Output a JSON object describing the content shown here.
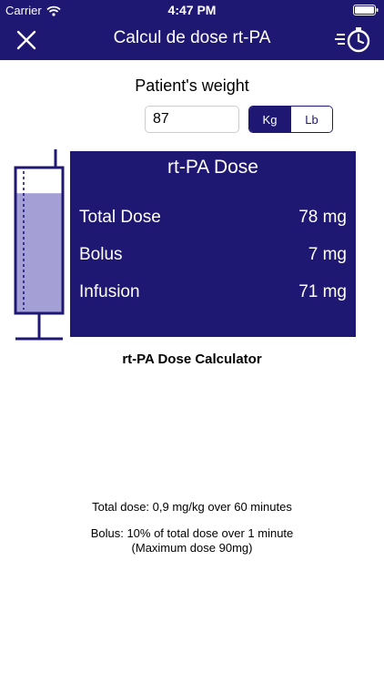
{
  "status_bar": {
    "carrier": "Carrier",
    "time": "4:47 PM"
  },
  "nav": {
    "title": "Calcul de dose rt-PA",
    "close_icon": "close-icon",
    "timer_icon": "stopwatch-icon"
  },
  "weight": {
    "label": "Patient's weight",
    "value": "87",
    "units": {
      "kg": "Kg",
      "lb": "Lb",
      "selected": "Kg"
    }
  },
  "syringe": {
    "fill_fraction": 0.83,
    "fill_color": "#a49fd4",
    "outline_color": "#1f1873"
  },
  "dose": {
    "title": "rt-PA Dose",
    "rows": [
      {
        "label": "Total Dose",
        "value": "78 mg"
      },
      {
        "label": "Bolus",
        "value": "7 mg"
      },
      {
        "label": "Infusion",
        "value": "71 mg"
      }
    ]
  },
  "calculator_label": "rt-PA Dose Calculator",
  "info": {
    "line1": "Total dose: 0,9 mg/kg over 60 minutes",
    "line2": "Bolus: 10% of total dose over 1 minute",
    "line3": "(Maximum dose 90mg)"
  },
  "colors": {
    "brand": "#1f1873",
    "background": "#ffffff"
  }
}
